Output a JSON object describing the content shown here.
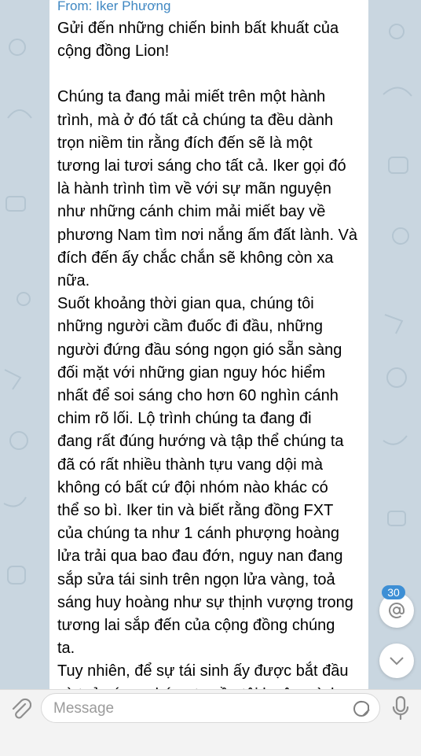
{
  "message": {
    "from": "From: Iker Phương",
    "paragraphs": [
      "Gửi đến những chiến binh bất khuất của\ncộng đồng Lion!",
      "Chúng ta đang mải miết trên một hành\ntrình, mà ở đó tất cả chúng ta đều dành\ntrọn niềm tin rằng đích đến sẽ là một\ntương lai tươi sáng cho tất cả. Iker gọi đó\nlà hành trình tìm về với sự mãn nguyện\nnhư những cánh chim mải miết bay về\nphương Nam tìm nơi nắng ấm đất lành. Và\nđích đến ấy chắc chắn sẽ không còn xa\nnữa.",
      "Suốt khoảng thời gian qua, chúng tôi\nnhững người cầm đuốc đi đầu, những\nngười đứng đầu sóng ngọn gió sẵn sàng\nđối mặt với những gian nguy hóc hiểm\nnhất để soi sáng cho hơn 60 nghìn cánh\nchim rõ lối. Lộ trình chúng ta đang đi\nđang rất đúng hướng và tập thể chúng ta\nđã có rất nhiều thành tựu vang dội mà\nkhông có bất cứ đội nhóm nào khác có\nthể so bì. Iker tin và biết rằng đồng FXT\ncủa chúng ta như 1 cánh phượng hoàng\nlửa trải qua bao đau đớn, nguy nan đang\nsắp sửa tái sinh trên ngọn lửa vàng, toả\nsáng huy hoàng như sự thịnh vượng trong\ntương lai sắp đến của cộng đồng chúng\nta.",
      "Tuy nhiên, để sự tái sinh ấy được bắt đầu\nvà toả sáng, chúng ta cần tôi luyện mình\nqua khổ đau không tưởng dưới ngọn lửa"
    ]
  },
  "mentions": {
    "count": "30",
    "icon": "at-icon"
  },
  "scroll_down": {
    "icon": "chevron-down-icon"
  },
  "composer": {
    "placeholder": "Message",
    "attach_icon": "paperclip-icon",
    "emoji_icon": "sticker-icon",
    "mic_icon": "microphone-icon"
  },
  "colors": {
    "sender_name": "#3f87c2",
    "chat_background": "#c9d6e0",
    "badge": "#3d8fd5"
  }
}
